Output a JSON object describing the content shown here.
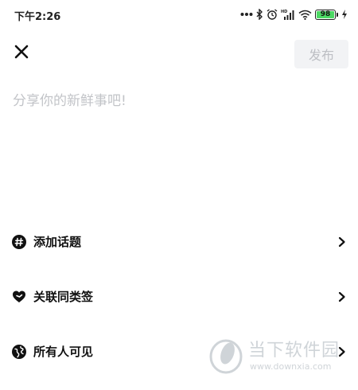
{
  "status_bar": {
    "time": "下午2:26",
    "battery_level": "98",
    "battery_fraction": 0.98,
    "icons": [
      "more-dots-icon",
      "bluetooth-icon",
      "alarm-icon",
      "hd-signal-icon",
      "wifi-icon",
      "battery-icon",
      "charging-icon"
    ],
    "hd_label": "HD"
  },
  "header": {
    "close_icon": "close-icon",
    "publish_label": "发布"
  },
  "compose": {
    "placeholder": "分享你的新鲜事吧!",
    "value": ""
  },
  "options": [
    {
      "icon": "hashtag-icon",
      "label": "添加话题"
    },
    {
      "icon": "heart-link-icon",
      "label": "关联同类签"
    },
    {
      "icon": "globe-icon",
      "label": "所有人可见"
    }
  ],
  "watermark": {
    "title": "当下软件园",
    "url": "www.downxia.com"
  },
  "colors": {
    "publish_bg": "#f2f3f5",
    "publish_text": "#bdbfc4",
    "placeholder": "#c2c4c8",
    "battery_green": "#4cd964"
  }
}
